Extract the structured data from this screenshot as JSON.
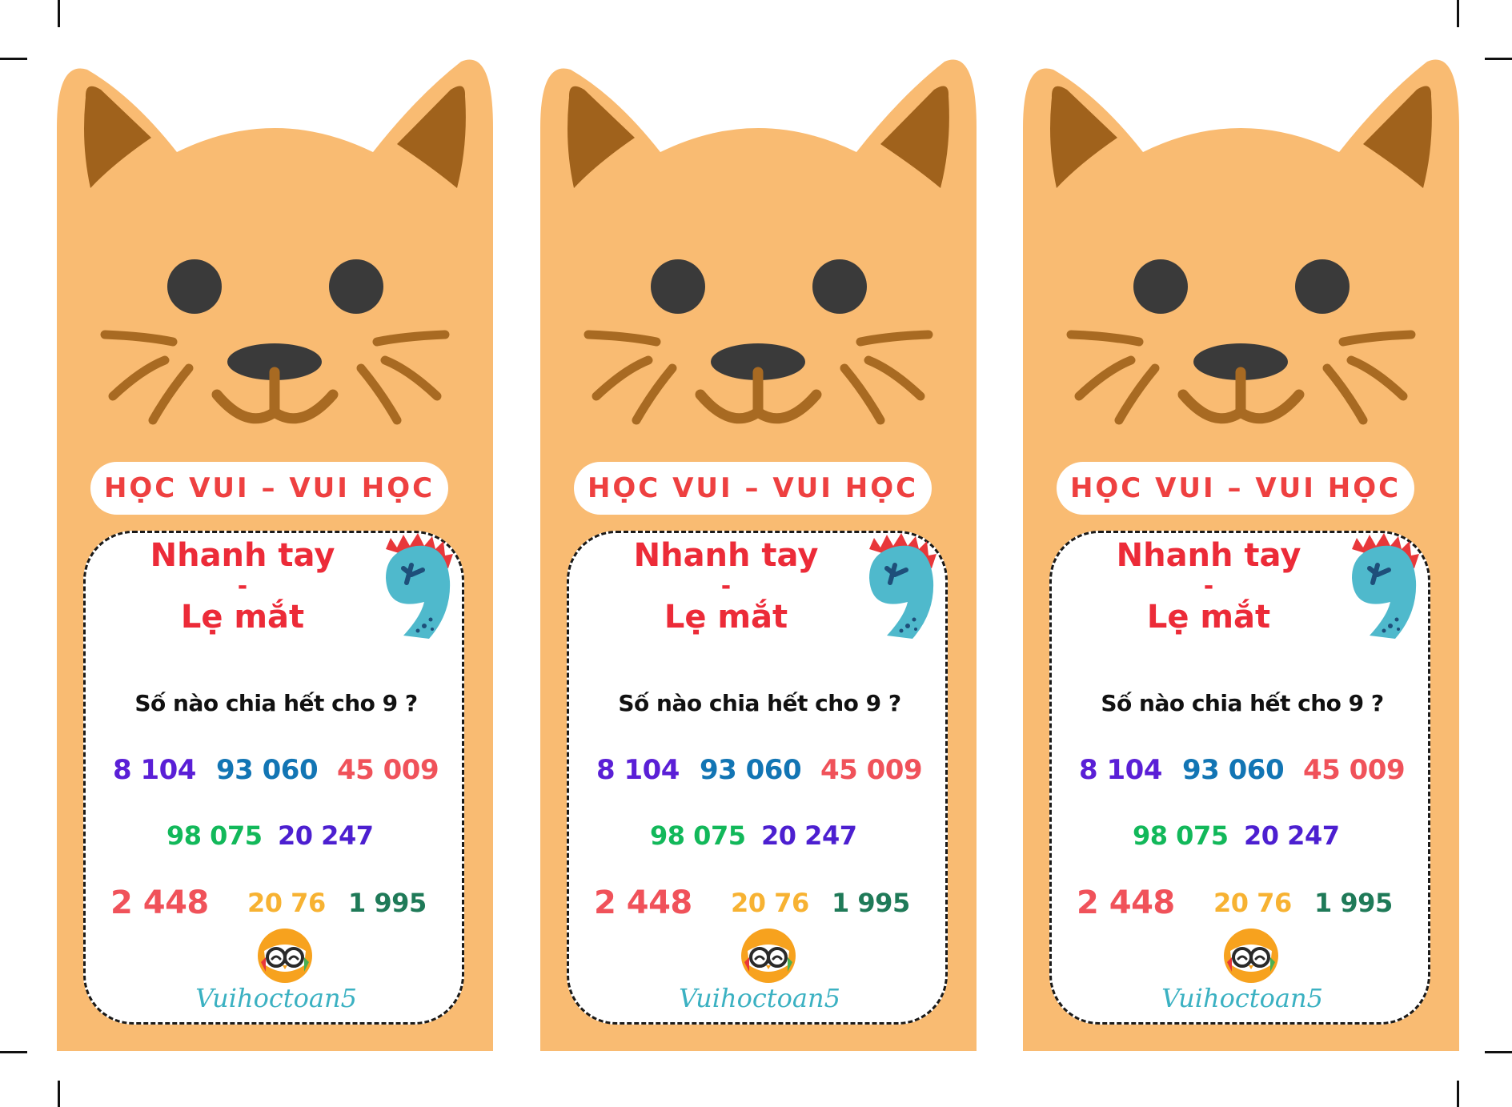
{
  "cards": [
    {
      "banner": "HỌC VUI – VUI HỌC",
      "title_line1": "Nhanh tay",
      "title_sep": "-",
      "title_line2": "Lẹ mắt",
      "question": "Số nào chia hết cho 9 ?",
      "numbers": [
        "8 104",
        "93 060",
        "45 009",
        "98 075",
        "20 247",
        "2 448",
        "20 76",
        "1 995"
      ],
      "brand": "Vuihoctoan5"
    },
    {
      "banner": "HỌC VUI – VUI HỌC",
      "title_line1": "Nhanh tay",
      "title_sep": "-",
      "title_line2": "Lẹ mắt",
      "question": "Số nào chia hết cho 9 ?",
      "numbers": [
        "8 104",
        "93 060",
        "45 009",
        "98 075",
        "20 247",
        "2 448",
        "20 76",
        "1 995"
      ],
      "brand": "Vuihoctoan5"
    },
    {
      "banner": "HỌC VUI – VUI HỌC",
      "title_line1": "Nhanh tay",
      "title_sep": "-",
      "title_line2": "Lẹ mắt",
      "question": "Số nào chia hết cho 9 ?",
      "numbers": [
        "8 104",
        "93 060",
        "45 009",
        "98 075",
        "20 247",
        "2 448",
        "20 76",
        "1 995"
      ],
      "brand": "Vuihoctoan5"
    }
  ],
  "colors": {
    "cat_body": "#f9bb72",
    "cat_ear_inner": "#a0621c",
    "cat_features": "#a86a22",
    "eyes_nose": "#3a3a3a",
    "title_red": "#ec2b38",
    "num_purple": "#5a1fd6",
    "num_blue": "#1275b4",
    "num_coral": "#f0525a",
    "num_green": "#12b85a",
    "num_violet": "#4c1fd0",
    "num_orange": "#f7b232",
    "num_darkgreen": "#1f7a58",
    "nine_teal": "#4fb9cc",
    "brand_teal": "#3bb1c2"
  },
  "icons": [
    "cat-face-icon",
    "dinosaur-nine-icon",
    "owl-logo-icon"
  ]
}
